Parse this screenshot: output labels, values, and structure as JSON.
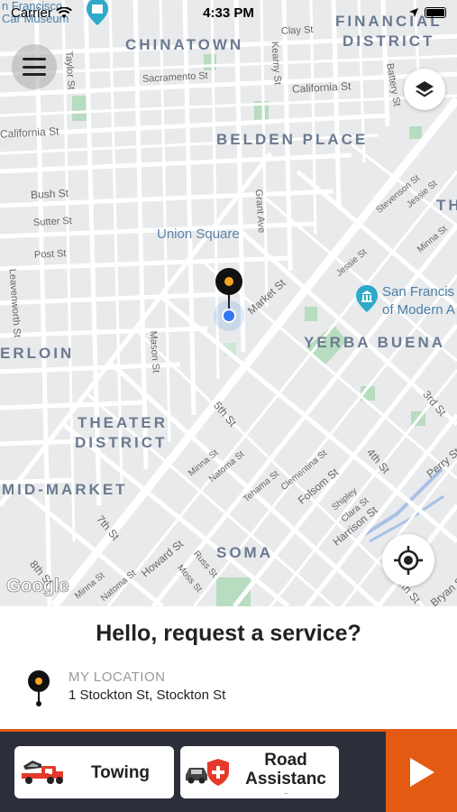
{
  "status_bar": {
    "carrier": "Carrier",
    "time": "4:33 PM"
  },
  "map": {
    "districts": [
      "CHINATOWN",
      "FINANCIAL",
      "DISTRICT",
      "BELDEN PLACE",
      "ERLOIN",
      "YERBA BUENA",
      "THEATER",
      "DISTRICT",
      "MID-MARKET",
      "SOMA",
      "TH"
    ],
    "pois": [
      "Union Square",
      "San Francis",
      "of Modern A",
      "n Francisco",
      "Car Museum"
    ],
    "streets": [
      "Clay St",
      "Sacramento St",
      "California St",
      "California St",
      "Taylor St",
      "Kearny St",
      "Battery St",
      "Bush St",
      "Sutter St",
      "Post St",
      "Grant Ave",
      "Stevenson St",
      "Jessie St",
      "Minna St",
      "Jessie St",
      "Market St",
      "Leavenworth St",
      "Mason St",
      "5th St",
      "Minna St",
      "Natoma St",
      "Tehama St",
      "Clementina St",
      "Folsom St",
      "Shipley",
      "Clara St",
      "4th St",
      "Harrison St",
      "3rd St",
      "Perry St",
      "7th St",
      "8th St",
      "Howard St",
      "Russ St",
      "Moss St",
      "Minna St",
      "Natoma St",
      "5th St",
      "Bryan St"
    ],
    "attribution": "Google"
  },
  "sheet": {
    "headline": "Hello, request a service?",
    "location_caption": "MY LOCATION",
    "location_value": "1 Stockton St, Stockton St"
  },
  "services": [
    {
      "label": "Towing",
      "icon": "tow-truck-icon"
    },
    {
      "label": "Road\nAssistanc\ne",
      "icon": "road-assistance-icon"
    }
  ],
  "colors": {
    "accent": "#e35b12",
    "bar_background": "#2b2f3a",
    "pin_yellow": "#f5a623"
  }
}
